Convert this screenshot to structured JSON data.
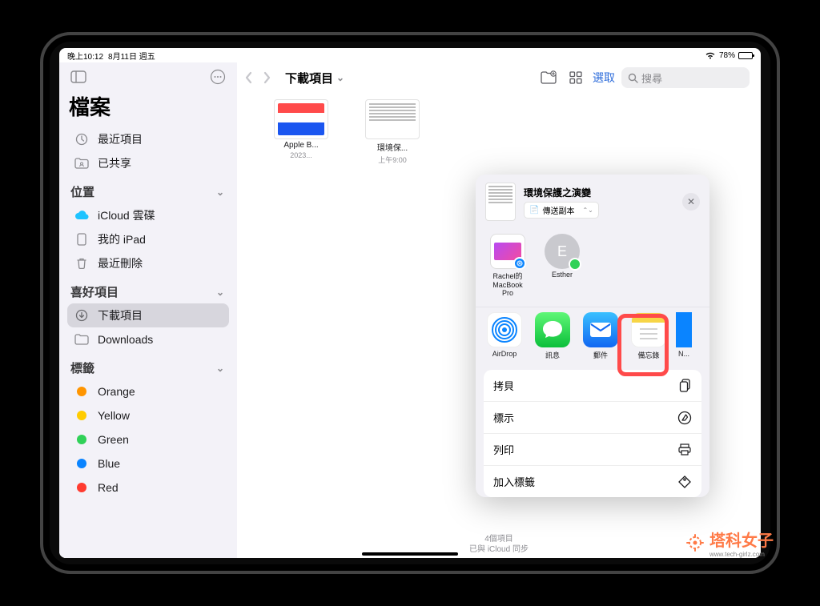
{
  "status": {
    "time": "晚上10:12",
    "date": "8月11日 週五",
    "battery": "78%"
  },
  "sidebar": {
    "title": "檔案",
    "recent": "最近項目",
    "shared": "已共享",
    "locations_heading": "位置",
    "icloud": "iCloud 雲碟",
    "my_ipad": "我的 iPad",
    "recently_deleted": "最近刪除",
    "favorites_heading": "喜好項目",
    "downloads_zh": "下載項目",
    "downloads_en": "Downloads",
    "tags_heading": "標籤",
    "tags": [
      {
        "label": "Orange",
        "color": "#ff9500"
      },
      {
        "label": "Yellow",
        "color": "#ffcc00"
      },
      {
        "label": "Green",
        "color": "#30d158"
      },
      {
        "label": "Blue",
        "color": "#0a84ff"
      },
      {
        "label": "Red",
        "color": "#ff3b30"
      }
    ]
  },
  "toolbar": {
    "title": "下載項目",
    "select": "選取",
    "search_placeholder": "搜尋"
  },
  "files": [
    {
      "name": "Apple B...",
      "date": "2023..."
    },
    {
      "name": "環境保...",
      "date": "上午9:00"
    }
  ],
  "share": {
    "title": "環境保護之演變",
    "mode": "傳送副本",
    "targets": [
      {
        "label": "Rachel的\nMacBook\nPro",
        "kind": "device"
      },
      {
        "label": "Esther",
        "kind": "contact",
        "initial": "E"
      }
    ],
    "apps": [
      {
        "label": "AirDrop",
        "kind": "airdrop"
      },
      {
        "label": "訊息",
        "kind": "messages"
      },
      {
        "label": "郵件",
        "kind": "mail"
      },
      {
        "label": "備忘錄",
        "kind": "notes"
      },
      {
        "label": "N...",
        "kind": "next"
      }
    ],
    "actions": {
      "copy": "拷貝",
      "markup": "標示",
      "print": "列印",
      "add_tag": "加入標籤"
    }
  },
  "status_bottom": {
    "count": "4個項目",
    "sync": "已與 iCloud 同步"
  },
  "watermark": {
    "text": "塔科女子",
    "url": "www.tech-girlz.com"
  }
}
